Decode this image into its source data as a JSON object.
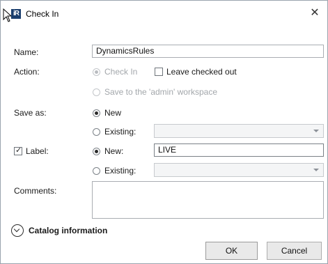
{
  "window": {
    "title": "Check In",
    "icon_text": "iR"
  },
  "fields": {
    "name_label": "Name:",
    "name_value": "DynamicsRules",
    "action_label": "Action:",
    "action_checkin_label": "Check In",
    "leave_checked_out_label": "Leave checked out",
    "save_workspace_label": "Save to the 'admin' workspace",
    "save_as_label": "Save as:",
    "save_as_new_label": "New",
    "save_as_existing_label": "Existing:",
    "label_label": "Label:",
    "label_new_label": "New:",
    "label_new_value": "LIVE",
    "label_existing_label": "Existing:",
    "comments_label": "Comments:"
  },
  "section": {
    "catalog_label": "Catalog information"
  },
  "buttons": {
    "ok": "OK",
    "cancel": "Cancel"
  }
}
